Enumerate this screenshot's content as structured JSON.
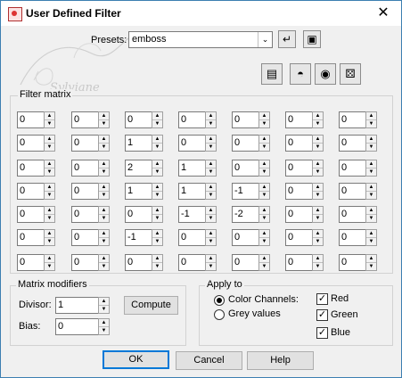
{
  "window": {
    "title": "User Defined Filter",
    "close_glyph": "✕"
  },
  "watermark": {
    "text": "Sylviane"
  },
  "presets": {
    "label": "Presets:",
    "value": "emboss",
    "arrow": "⌄",
    "icons": [
      "reset-icon",
      "save-preset-icon"
    ]
  },
  "toolbar_icons": [
    "edit-presets-icon",
    "lock-icon",
    "eye-icon",
    "randomize-icon"
  ],
  "filter_matrix": {
    "label": "Filter matrix",
    "rows": [
      [
        "0",
        "0",
        "0",
        "0",
        "0",
        "0",
        "0"
      ],
      [
        "0",
        "0",
        "1",
        "0",
        "0",
        "0",
        "0"
      ],
      [
        "0",
        "0",
        "2",
        "1",
        "0",
        "0",
        "0"
      ],
      [
        "0",
        "0",
        "1",
        "1",
        "-1",
        "0",
        "0"
      ],
      [
        "0",
        "0",
        "0",
        "-1",
        "-2",
        "0",
        "0"
      ],
      [
        "0",
        "0",
        "-1",
        "0",
        "0",
        "0",
        "0"
      ],
      [
        "0",
        "0",
        "0",
        "0",
        "0",
        "0",
        "0"
      ]
    ]
  },
  "matrix_modifiers": {
    "label": "Matrix modifiers",
    "divisor_label": "Divisor:",
    "divisor_value": "1",
    "bias_label": "Bias:",
    "bias_value": "0",
    "compute_label": "Compute"
  },
  "apply_to": {
    "label": "Apply to",
    "color_channels_label": "Color Channels:",
    "grey_values_label": "Grey values",
    "selected": "color_channels",
    "red_label": "Red",
    "green_label": "Green",
    "blue_label": "Blue",
    "red_checked": true,
    "green_checked": true,
    "blue_checked": true
  },
  "buttons": {
    "ok": "OK",
    "cancel": "Cancel",
    "help": "Help"
  }
}
